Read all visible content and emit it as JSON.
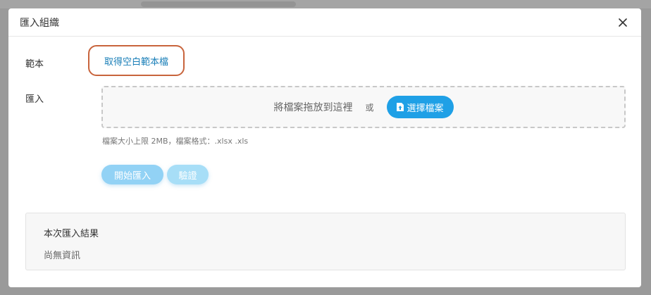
{
  "dialog": {
    "title": "匯入組織"
  },
  "template": {
    "label": "範本",
    "link_text": "取得空白範本檔"
  },
  "import": {
    "label": "匯入",
    "drop_text": "將檔案拖放到這裡",
    "or_text": "或",
    "choose_button": "選擇檔案",
    "hint": "檔案大小上限 2MB，檔案格式：.xlsx .xls"
  },
  "actions": {
    "start_import": "開始匯入",
    "validate": "驗證"
  },
  "result": {
    "title": "本次匯入結果",
    "empty": "尚無資訊"
  },
  "colors": {
    "highlight_border": "#c8643c",
    "link": "#1a7fb8",
    "primary": "#1fa0e6"
  },
  "icons": {
    "close": "close-icon",
    "file_upload": "file-upload-icon"
  }
}
